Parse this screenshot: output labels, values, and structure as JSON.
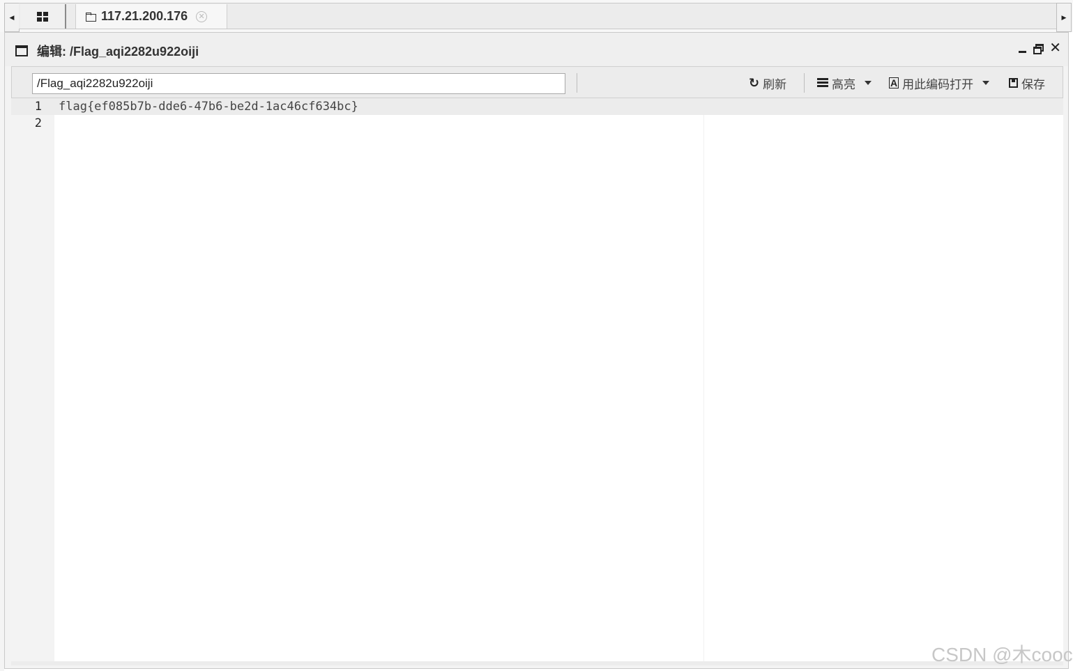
{
  "tabs": {
    "home_icon": "grid-icon",
    "host_tab": {
      "icon": "folder-icon",
      "label": "117.21.200.176",
      "close_icon": "close-circle-icon"
    },
    "scroll_left": "◀",
    "scroll_right": "▶"
  },
  "window": {
    "title": "编辑: /Flag_aqi2282u922oiji",
    "controls": [
      "minimize",
      "restore",
      "close"
    ]
  },
  "toolbar": {
    "path_value": "/Flag_aqi2282u922oiji",
    "refresh_label": "刷新",
    "highlight_label": "高亮",
    "encoding_label": "用此编码打开",
    "save_label": "保存"
  },
  "editor": {
    "lines": [
      {
        "number": "1",
        "text": "flag{ef085b7b-dde6-47b6-be2d-1ac46cf634bc}"
      },
      {
        "number": "2",
        "text": ""
      }
    ]
  },
  "watermark": "CSDN @木cooc"
}
